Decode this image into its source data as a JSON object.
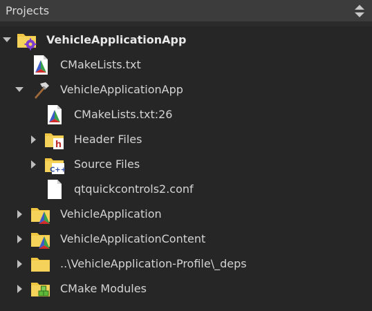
{
  "header": {
    "title": "Projects",
    "sort_icon": "up-down-arrows-icon"
  },
  "tree": {
    "root_label": "VehicleApplicationApp",
    "cmakelists_label": "CMakeLists.txt",
    "app_target_label": "VehicleApplicationApp",
    "cmakelists26_label": "CMakeLists.txt:26",
    "header_files_label": "Header Files",
    "source_files_label": "Source Files",
    "conf_label": "qtquickcontrols2.conf",
    "vehicle_app_label": "VehicleApplication",
    "vehicle_content_label": "VehicleApplicationContent",
    "deps_label": "..\\VehicleApplication-Profile\\_deps",
    "cmake_modules_label": "CMake Modules"
  },
  "colors": {
    "folder": "#f0c542",
    "cmake_red": "#d22b2b",
    "cmake_green": "#3aa14a",
    "cmake_blue": "#3c5ac8",
    "gear_purple": "#7a3bd1",
    "header_h": "#c0302b",
    "modules_green": "#5fb83a"
  }
}
